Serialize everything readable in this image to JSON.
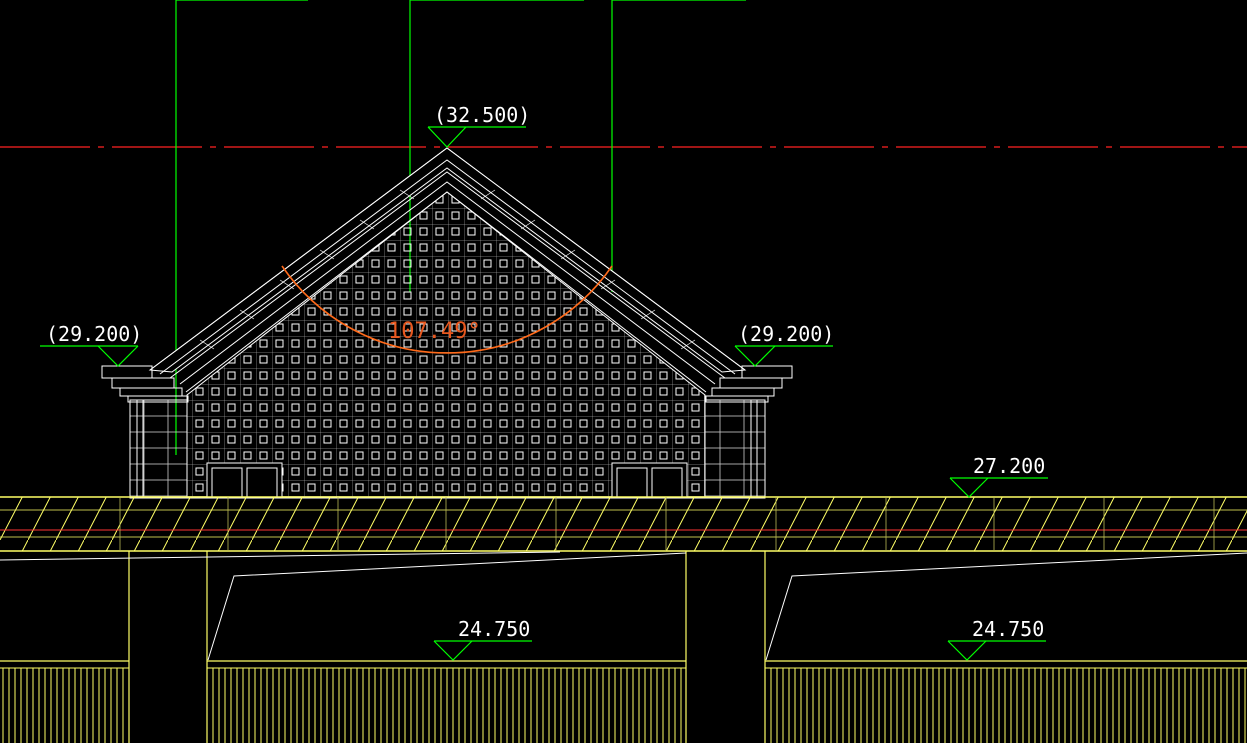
{
  "drawing": {
    "background": "#000000",
    "colors": {
      "leader": "#00ff00",
      "structure": "#ffff66",
      "axis": "#ff2222",
      "dimension": "#ff6a1a",
      "linework": "#ffffff"
    },
    "elevations": {
      "ridge": "(32.500)",
      "eave_left": "(29.200)",
      "eave_right": "(29.200)",
      "deck": "27.200",
      "lower_left": "24.750",
      "lower_right": "24.750"
    },
    "angle_dimension": "107.49°",
    "icons": [
      "elevation-marker-icon"
    ]
  }
}
